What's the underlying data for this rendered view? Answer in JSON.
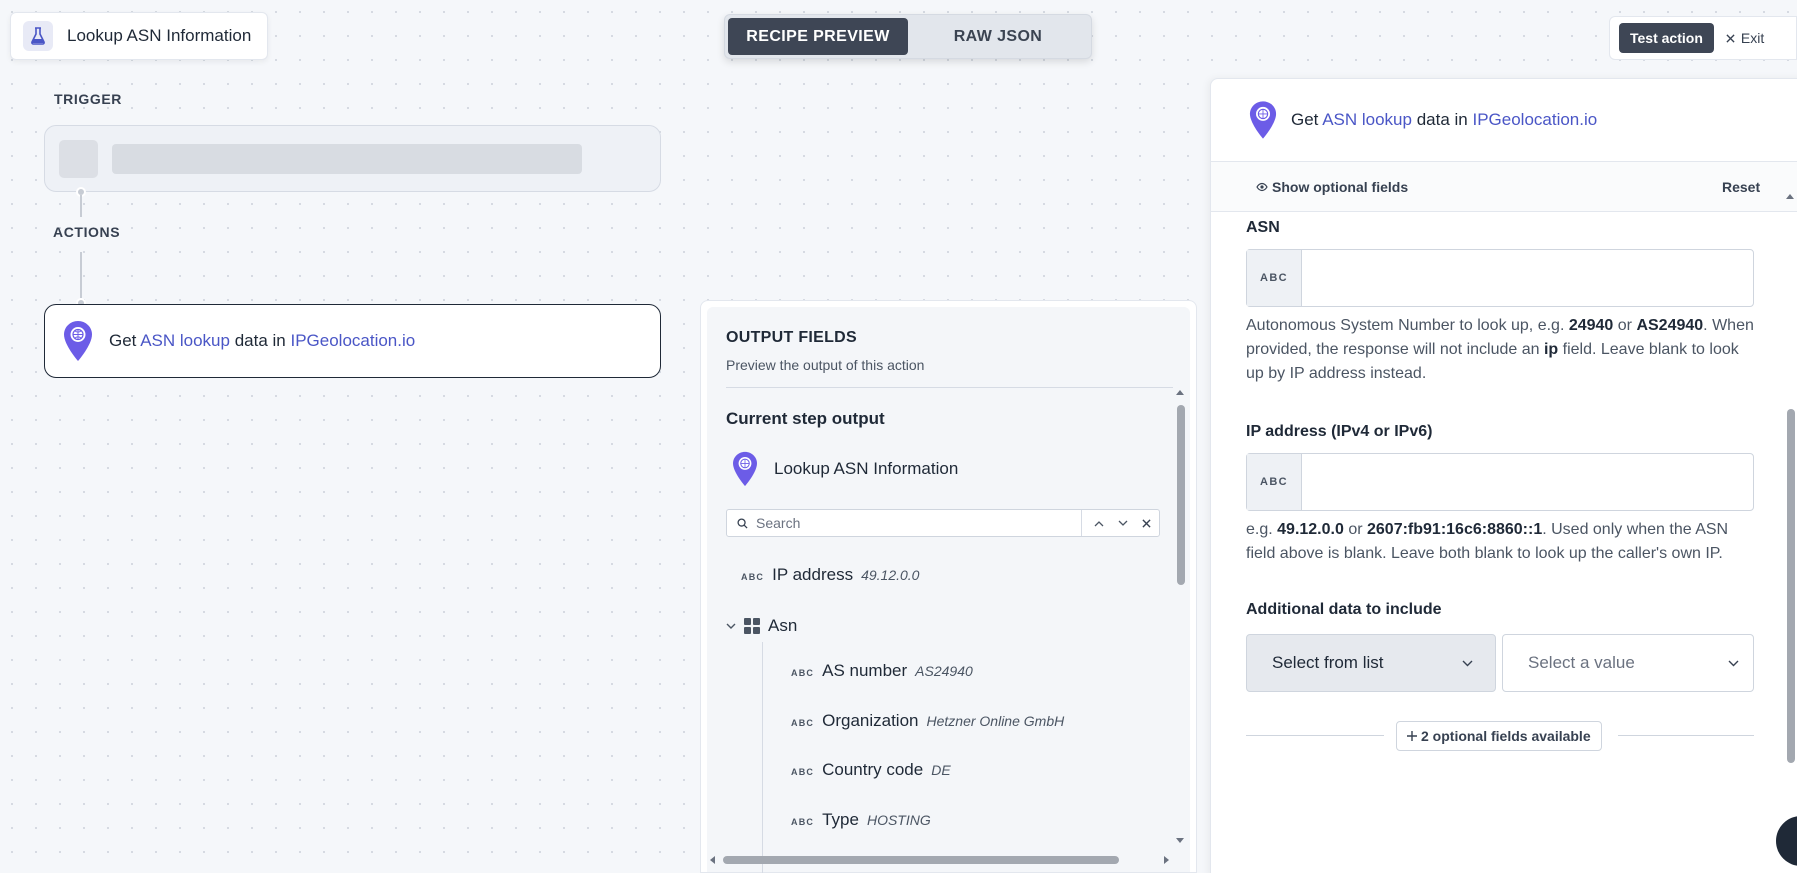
{
  "recipe": {
    "title": "Lookup ASN Information"
  },
  "view_toggle": {
    "recipe_preview": "RECIPE PREVIEW",
    "raw_json": "RAW JSON"
  },
  "top_actions": {
    "test_action": "Test action",
    "exit": "Exit"
  },
  "canvas": {
    "trigger_label": "TRIGGER",
    "actions_label": "ACTIONS",
    "action_step": {
      "prefix": "Get ",
      "link1": "ASN lookup",
      "middle": " data in ",
      "link2": "IPGeolocation.io"
    }
  },
  "output_panel": {
    "title": "OUTPUT FIELDS",
    "subtitle": "Preview the output of this action",
    "current_step_heading": "Current step output",
    "step_name": "Lookup ASN Information",
    "search_placeholder": "Search",
    "fields": [
      {
        "type": "ABC",
        "label": "IP address",
        "sample": "49.12.0.0"
      }
    ],
    "group": {
      "label": "Asn",
      "children": [
        {
          "type": "ABC",
          "label": "AS number",
          "sample": "AS24940"
        },
        {
          "type": "ABC",
          "label": "Organization",
          "sample": "Hetzner Online GmbH"
        },
        {
          "type": "ABC",
          "label": "Country code",
          "sample": "DE"
        },
        {
          "type": "ABC",
          "label": "Type",
          "sample": "HOSTING"
        }
      ]
    }
  },
  "config_panel": {
    "header": {
      "prefix": "Get ",
      "link1": "ASN lookup",
      "middle": " data in ",
      "link2": "IPGeolocation.io"
    },
    "show_optional": "Show optional fields",
    "reset": "Reset",
    "asn": {
      "label": "ASN",
      "type": "ABC",
      "value": "",
      "help": {
        "t1": "Autonomous System Number to look up, e.g. ",
        "b1": "24940",
        "t2": " or ",
        "b2": "AS24940",
        "t3": ". When provided, the response will not include an ",
        "b3": "ip",
        "t4": " field. Leave blank to look up by IP address instead."
      }
    },
    "ip": {
      "label": "IP address (IPv4 or IPv6)",
      "type": "ABC",
      "value": "",
      "help": {
        "t1": "e.g. ",
        "b1": "49.12.0.0",
        "t2": " or ",
        "b2": "2607:fb91:16c6:8860::1",
        "t3": ". Used only when the ASN field above is blank. Leave both blank to look up the caller's own IP."
      }
    },
    "additional": {
      "label": "Additional data to include",
      "select_mode": "Select from list",
      "select_value_placeholder": "Select a value"
    },
    "optional_fields_button": "2 optional fields available"
  },
  "icons": {
    "flask": "flask-icon",
    "location_pin": "location-pin-icon",
    "search": "search-icon",
    "chevron_up": "chevron-up-icon",
    "chevron_down": "chevron-down-icon",
    "close": "close-icon",
    "grid": "grid-icon",
    "eye": "eye-icon",
    "plus": "plus-icon"
  },
  "colors": {
    "link": "#4a56c6",
    "pin": "#6c5ce7",
    "dark_button": "#3e4655"
  }
}
